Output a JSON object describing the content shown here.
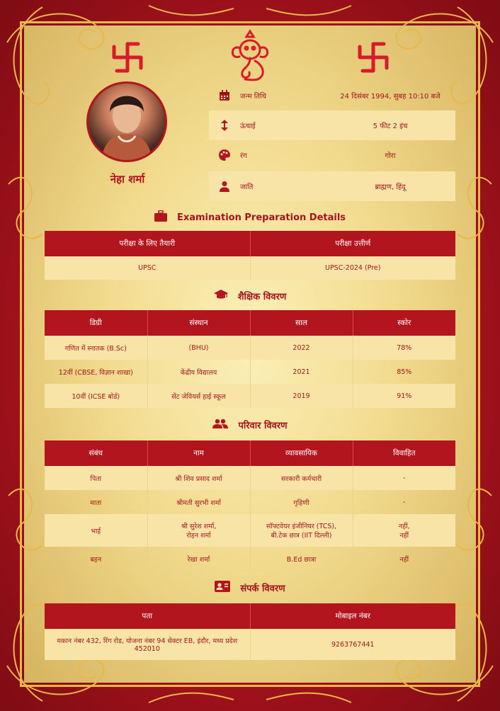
{
  "profile": {
    "name": "नेहा शर्मा"
  },
  "details": [
    {
      "icon": "calendar-icon",
      "label": "जन्म तिथि",
      "value": "24 दिसंबर 1994, सुबह 10:10 बजे"
    },
    {
      "icon": "height-arrows-icon",
      "label": "ऊंचाई",
      "value": "5 फीट 2 इंच"
    },
    {
      "icon": "palette-icon",
      "label": "रंग",
      "value": "गोरा"
    },
    {
      "icon": "person-icon",
      "label": "जाति",
      "value": "ब्राह्मण, हिंदू"
    }
  ],
  "exam": {
    "title": "Examination Preparation Details",
    "headers": [
      "परीक्षा के लिए तैयारी",
      "परीक्षा उत्तीर्ण"
    ],
    "rows": [
      [
        "UPSC",
        "UPSC-2024 (Pre)"
      ]
    ]
  },
  "education": {
    "title": "शैक्षिक विवरण",
    "headers": [
      "डिग्री",
      "संस्थान",
      "साल",
      "स्कोर"
    ],
    "rows": [
      [
        "गणित में स्नातक (B.Sc)",
        "(BHU)",
        "2022",
        "78%"
      ],
      [
        "12वीं (CBSE, विज्ञान शाखा)",
        "केंद्रीय विद्यालय",
        "2021",
        "85%"
      ],
      [
        "10वीं (ICSE बोर्ड)",
        "सेंट जेवियर्स हाई स्कूल",
        "2019",
        "91%"
      ]
    ]
  },
  "family": {
    "title": "परिवार विवरण",
    "headers": [
      "संबंध",
      "नाम",
      "व्यावसायिक",
      "विवाहित"
    ],
    "rows": [
      [
        "पिता",
        "श्री शिव प्रसाद शर्मा",
        "सरकारी कर्मचारी",
        "-"
      ],
      [
        "माता",
        "श्रीमती सुरभी शर्मा",
        "गृहिणी",
        "-"
      ],
      [
        "भाई",
        "श्री सुरेश शर्मा,\nरोहन शर्मा",
        "सॉफ्टवेयर इंजीनियर (TCS),\nबी.टेक छात्र (IIT दिल्ली)",
        "नहीं,\nनहीं"
      ],
      [
        "बहन",
        "रेखा शर्मा",
        "B.Ed छात्रा",
        "नहीं"
      ]
    ]
  },
  "contact": {
    "title": "संपर्क विवरण",
    "headers": [
      "पता",
      "मोबाइल नंबर"
    ],
    "rows": [
      [
        "मकान नंबर 432, रिंग रोड, योजना नंबर 94 सेक्टर EB, इंदौर, मध्य प्रदेश 452010",
        "9263767441"
      ]
    ]
  },
  "colors": {
    "accent": "#b3151f",
    "gold": "#e9b84a",
    "row": "#f8e4a6"
  }
}
